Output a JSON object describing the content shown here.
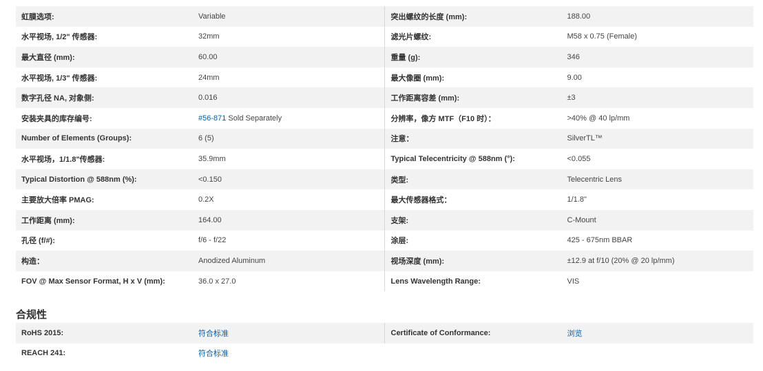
{
  "specs": [
    {
      "l_label": "虹膜选项:",
      "l_value": "Variable",
      "r_label": "突出螺纹的长度 (mm):",
      "r_value": "188.00"
    },
    {
      "l_label": "水平视场, 1/2\" 传感器:",
      "l_value": "32mm",
      "r_label": "滤光片螺纹:",
      "r_value": "M58 x 0.75 (Female)"
    },
    {
      "l_label": "最大直径 (mm):",
      "l_value": "60.00",
      "r_label": "重量 (g):",
      "r_value": "346"
    },
    {
      "l_label": "水平视场, 1/3\" 传感器:",
      "l_value": "24mm",
      "r_label": "最大像圈 (mm):",
      "r_value": "9.00"
    },
    {
      "l_label": "数字孔径 NA, 对象侧:",
      "l_value": "0.016",
      "r_label": "工作距离容差 (mm):",
      "r_value": "±3"
    },
    {
      "l_label": "安装夹具的库存编号:",
      "l_value_link": "#56-871",
      "l_value": " Sold Separately",
      "r_label": "分辨率，像方 MTF（F10 时）：",
      "r_value": ">40% @ 40 lp/mm"
    },
    {
      "l_label": "Number of Elements (Groups):",
      "l_value": "6 (5)",
      "r_label": "注意：",
      "r_value": "SilverTL™"
    },
    {
      "l_label": "水平视场，1/1.8\"传感器:",
      "l_value": "35.9mm",
      "r_label": "Typical Telecentricity @ 588nm (°):",
      "r_value": "<0.055"
    },
    {
      "l_label": "Typical Distortion @ 588nm (%):",
      "l_value": "<0.150",
      "r_label": "类型:",
      "r_value": "Telecentric Lens"
    },
    {
      "l_label": "主要放大倍率 PMAG:",
      "l_value": "0.2X",
      "r_label": "最大传感器格式：",
      "r_value": "1/1.8\""
    },
    {
      "l_label": "工作距离 (mm):",
      "l_value": "164.00",
      "r_label": "支架:",
      "r_value": "C-Mount"
    },
    {
      "l_label": "孔径 (f/#):",
      "l_value": "f/6 - f/22",
      "r_label": "涂层:",
      "r_value": "425 - 675nm BBAR"
    },
    {
      "l_label": "构造：",
      "l_value": "Anodized Aluminum",
      "r_label": "视场深度 (mm):",
      "r_value": "±12.9 at f/10 (20% @ 20 lp/mm)"
    },
    {
      "l_label": "FOV @ Max Sensor Format, H x V (mm):",
      "l_value": "36.0 x 27.0",
      "r_label": "Lens Wavelength Range:",
      "r_value": "VIS"
    }
  ],
  "compliance": {
    "heading": "合规性",
    "rows": [
      {
        "l_label": "RoHS 2015:",
        "l_value": "符合标准",
        "r_label": "Certificate of Conformance:",
        "r_value": "浏览"
      },
      {
        "l_label": "REACH 241:",
        "l_value": "符合标准"
      }
    ]
  }
}
